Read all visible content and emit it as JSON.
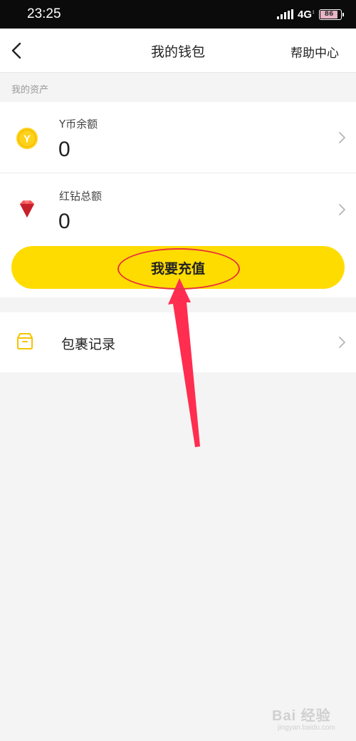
{
  "status_bar": {
    "time": "23:25",
    "network": "4G",
    "battery_level": "86",
    "battery_percent": 86
  },
  "nav": {
    "title": "我的钱包",
    "help": "帮助中心",
    "back_icon": "chevron-left-icon"
  },
  "assets": {
    "section_title": "我的资产",
    "items": [
      {
        "label": "Y币余额",
        "value": "0",
        "icon": "y-coin-icon",
        "icon_glyph": "Y"
      },
      {
        "label": "红钻总额",
        "value": "0",
        "icon": "red-diamond-icon"
      }
    ],
    "recharge_label": "我要充值"
  },
  "parcel": {
    "label": "包裹记录",
    "icon": "parcel-box-icon"
  },
  "watermark": {
    "brand": "Bai 经验",
    "url": "jingyan.baidu.com"
  },
  "colors": {
    "accent_yellow": "#ffdc00",
    "annotation_red": "#e8333f",
    "background": "#f4f4f4"
  }
}
